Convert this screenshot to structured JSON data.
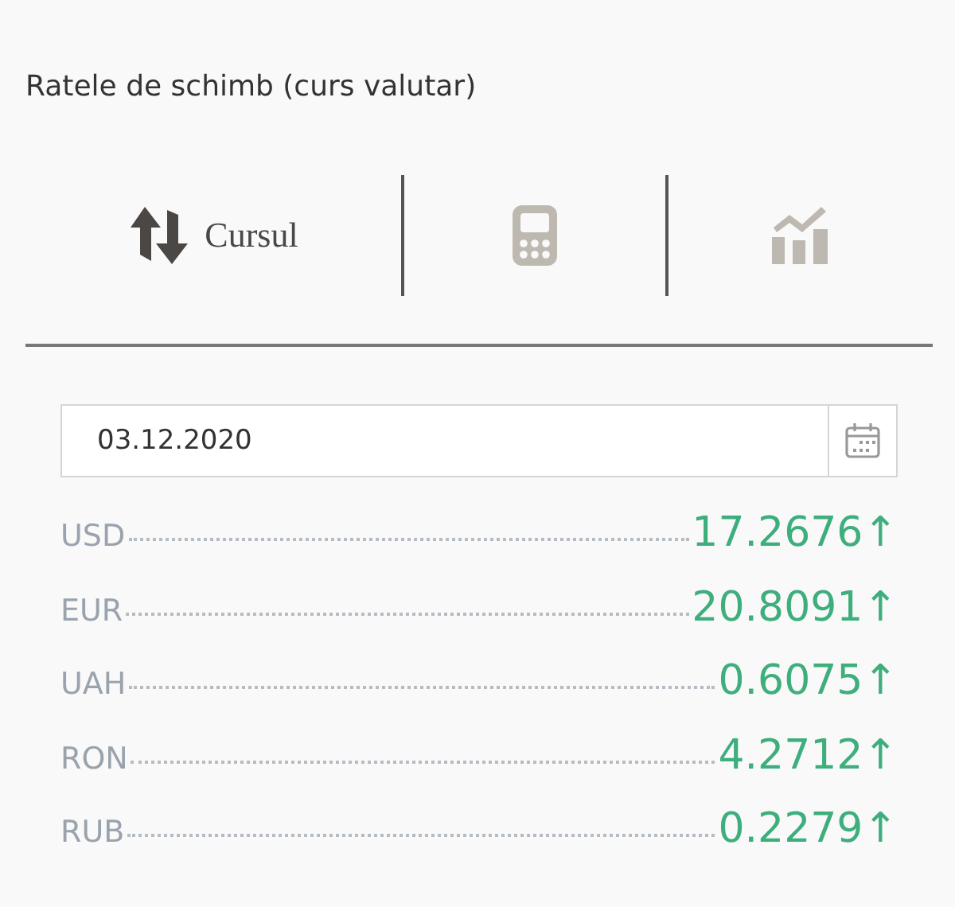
{
  "title": "Ratele de schimb (curs valutar)",
  "tabs": [
    {
      "kind": "rates",
      "label": "Cursul",
      "selected": true
    },
    {
      "kind": "calculator",
      "selected": false
    },
    {
      "kind": "chart",
      "selected": false
    }
  ],
  "date_field": {
    "value": "03.12.2020"
  },
  "rates": [
    {
      "currency": "USD",
      "value": "17.2676",
      "arrow": "↑"
    },
    {
      "currency": "EUR",
      "value": "20.8091",
      "arrow": "↑"
    },
    {
      "currency": "UAH",
      "value": "0.6075",
      "arrow": "↑"
    },
    {
      "currency": "RON",
      "value": "4.2712",
      "arrow": "↑"
    },
    {
      "currency": "RUB",
      "value": "0.2279",
      "arrow": "↑"
    }
  ]
}
